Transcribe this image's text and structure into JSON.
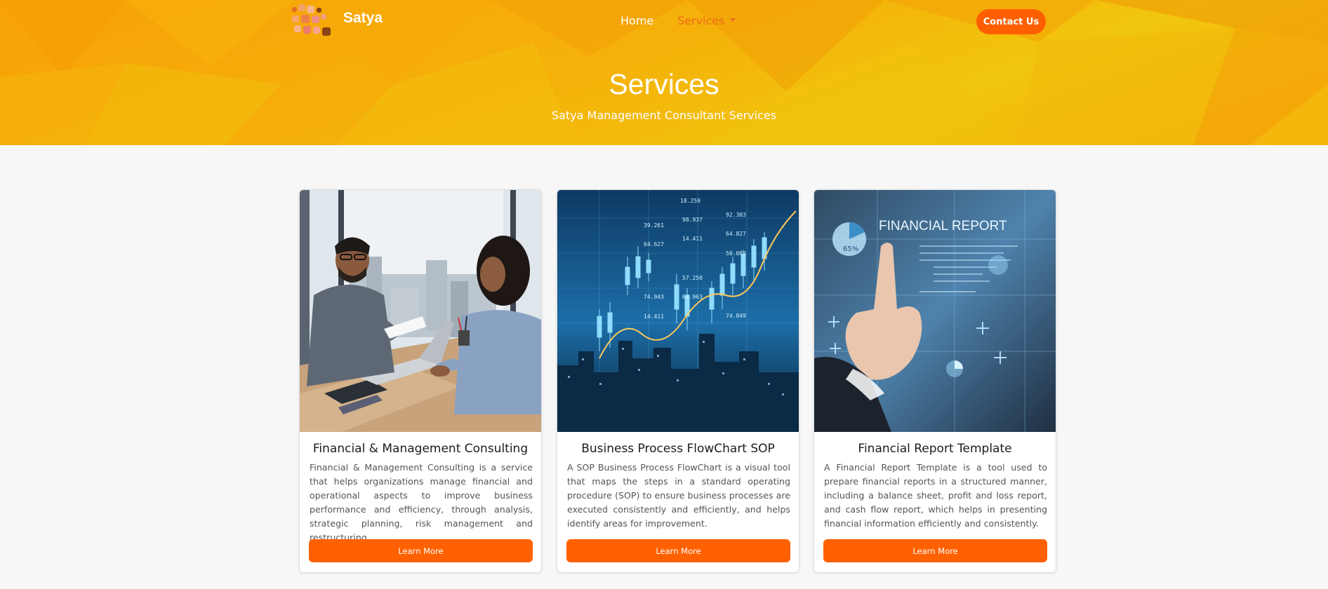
{
  "header": {
    "brand": "Satya",
    "nav": {
      "home": "Home",
      "services": "Services"
    },
    "contact_label": "Contact Us"
  },
  "hero": {
    "title": "Services",
    "subtitle": "Satya Management Consultant Services"
  },
  "cards": [
    {
      "title": "Financial & Management Consulting",
      "description": "Financial & Management Consulting is a service that helps organizations manage financial and operational aspects to improve business performance and efficiency, through analysis, strategic planning, risk management and restructuring.",
      "button": "Learn More"
    },
    {
      "title": "Business Process FlowChart SOP",
      "description": "A SOP Business Process FlowChart is a visual tool that maps the steps in a standard operating procedure (SOP) to ensure business processes are executed consistently and efficiently, and helps identify areas for improvement.",
      "button": "Learn More"
    },
    {
      "title": "Financial Report Template",
      "description": "A Financial Report Template is a tool used to prepare financial reports in a structured manner, including a balance sheet, profit and loss report, and cash flow report, which helps in presenting financial information efficiently and consistently.",
      "button": "Learn More"
    }
  ],
  "image_text": {
    "report_heading": "FINANCIAL REPORT",
    "report_percent": "65%",
    "chart_numbers": [
      "18.259",
      "92.303",
      "98.937",
      "39.261",
      "64.827",
      "14.411",
      "64.627",
      "50.084",
      "57.250",
      "74.943",
      "74.849",
      "64.963",
      "14.411"
    ]
  },
  "colors": {
    "accent": "#ff6100",
    "nav_active": "#f26a1c",
    "hero_orange": "#f7a106",
    "hero_yellow": "#f1c50d"
  }
}
